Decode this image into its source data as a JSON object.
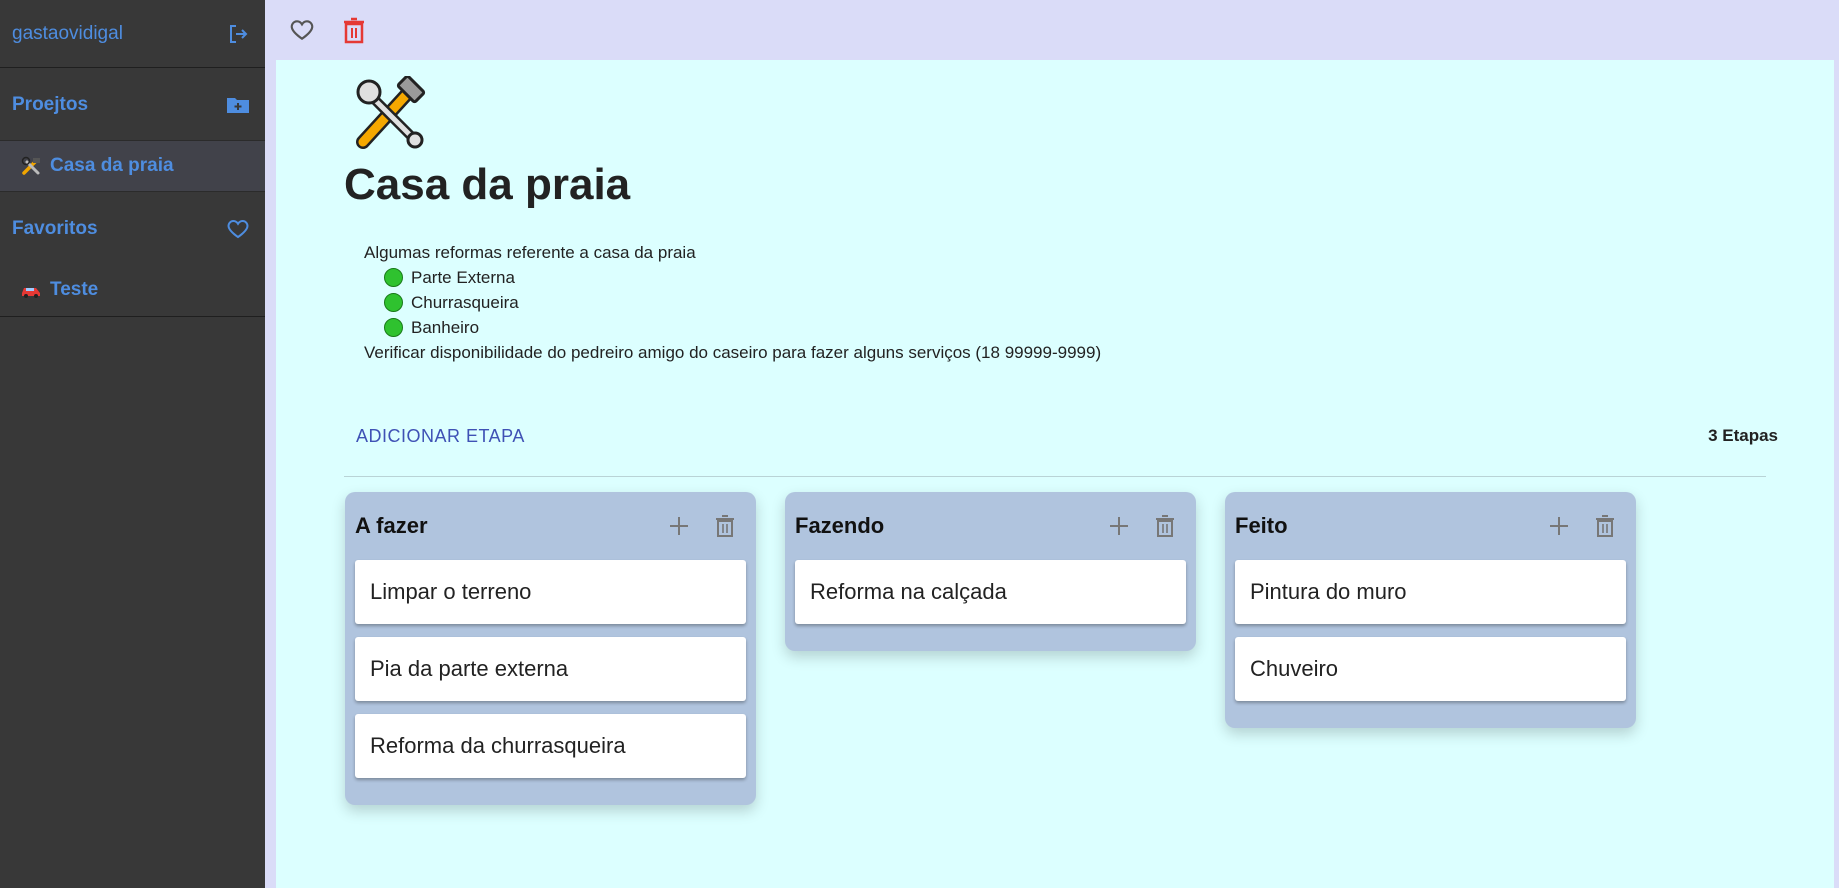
{
  "sidebar": {
    "username": "gastaovidigal",
    "projects_label": "Proejtos",
    "projects": [
      {
        "label": "Casa da praia",
        "icon": "hammer-and-wrench-emoji"
      }
    ],
    "favorites_label": "Favoritos",
    "favorites": [
      {
        "label": "Teste",
        "icon": "car-emoji"
      }
    ],
    "icons": {
      "logout": "logout-icon",
      "new_folder": "folder-plus-icon",
      "favorites": "heart-outline-icon"
    }
  },
  "topbar": {
    "icons": [
      "heart-outline-icon",
      "trash-icon"
    ]
  },
  "page": {
    "emoji": "hammer-and-wrench-emoji",
    "title": "Casa da praia",
    "description": {
      "intro": "Algumas reformas referente a casa da praia",
      "items": [
        "Parte Externa",
        "Churrasqueira",
        "Banheiro"
      ],
      "note": "Verificar disponibilidade do pedreiro amigo do caseiro para fazer alguns serviços (18 99999-9999)"
    }
  },
  "stages_bar": {
    "add_label": "ADICIONAR ETAPA",
    "count_label": "3 Etapas"
  },
  "columns": [
    {
      "title": "A fazer",
      "cards": [
        "Limpar o terreno",
        "Pia da parte externa",
        "Reforma da churrasqueira"
      ]
    },
    {
      "title": "Fazendo",
      "cards": [
        "Reforma na calçada"
      ]
    },
    {
      "title": "Feito",
      "cards": [
        "Pintura do muro",
        "Chuveiro"
      ]
    }
  ],
  "colors": {
    "sidebar_bg": "#383838",
    "sidebar_text": "#4e8de0",
    "topbar_bg": "#dadcf8",
    "main_bg": "#dcffff",
    "column_bg": "#b0c4de",
    "accent": "#3f51b5",
    "delete_red": "#e53935",
    "bullet_green": "#2fc22f"
  }
}
